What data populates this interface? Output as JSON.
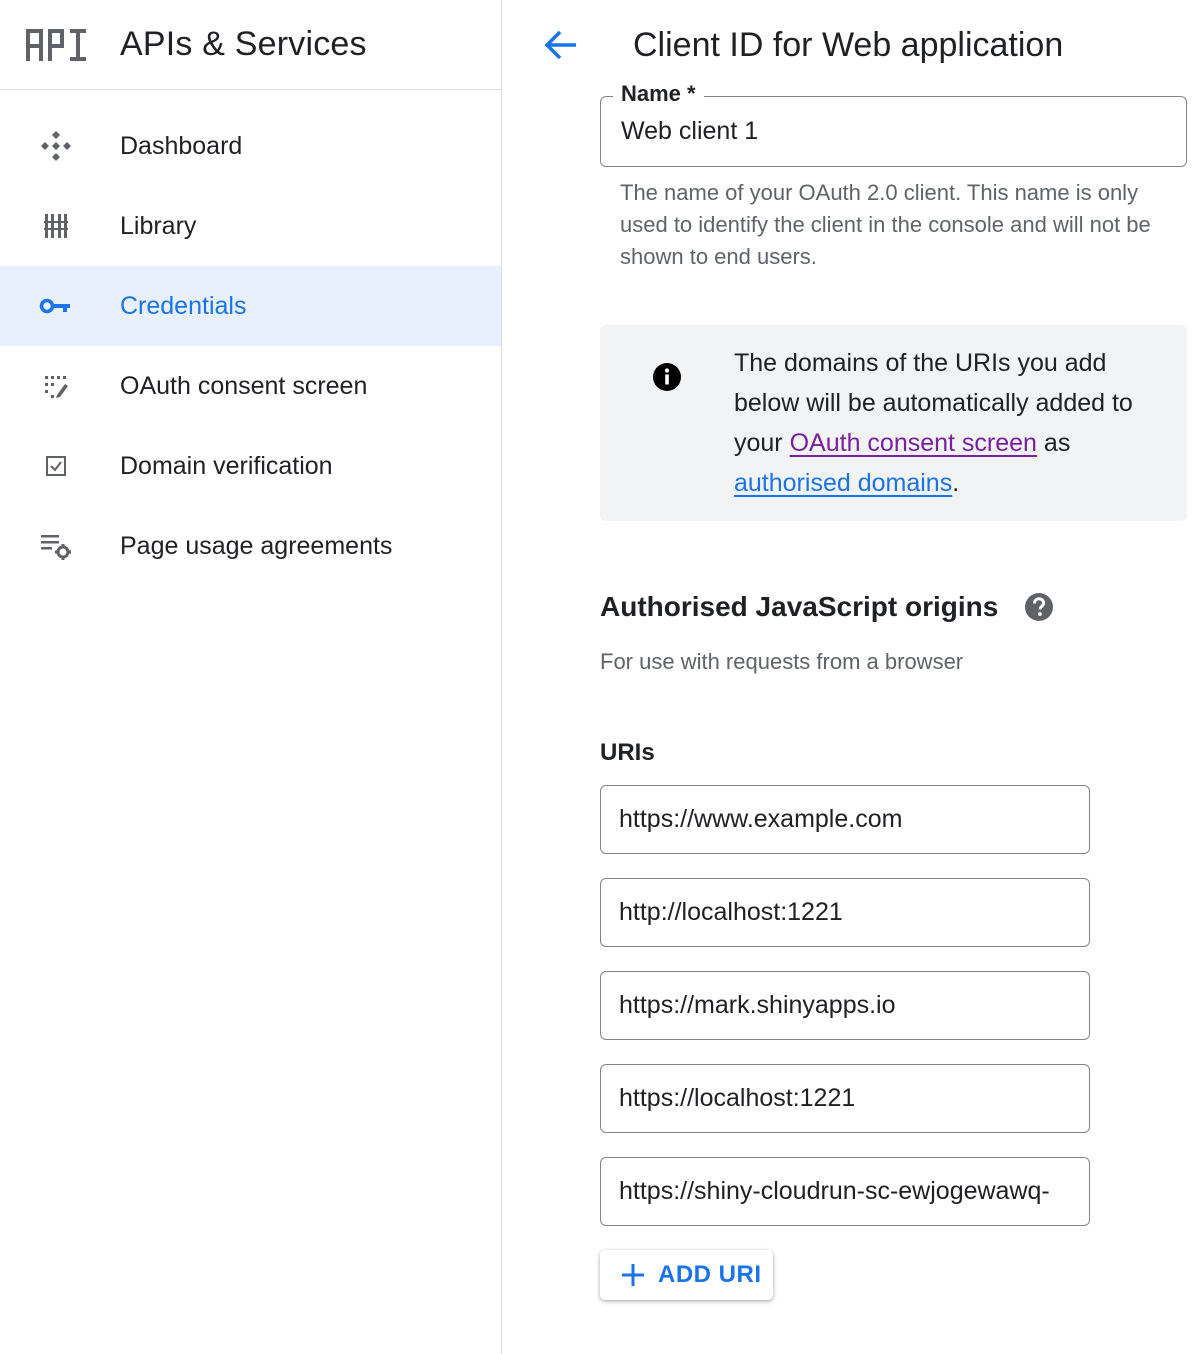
{
  "sidebar": {
    "logo_text": "API",
    "title": "APIs & Services",
    "items": [
      {
        "label": "Dashboard",
        "icon": "dashboard-icon"
      },
      {
        "label": "Library",
        "icon": "library-icon"
      },
      {
        "label": "Credentials",
        "icon": "key-icon",
        "active": true
      },
      {
        "label": "OAuth consent screen",
        "icon": "consent-icon"
      },
      {
        "label": "Domain verification",
        "icon": "checkbox-icon"
      },
      {
        "label": "Page usage agreements",
        "icon": "list-settings-icon"
      }
    ]
  },
  "header": {
    "title": "Client ID for Web application",
    "back_icon": "arrow-left-icon"
  },
  "form": {
    "name_label": "Name *",
    "name_value": "Web client 1",
    "name_hint": "The name of your OAuth 2.0 client. This name is only used to identify the client in the console and will not be shown to end users."
  },
  "info": {
    "text_before": "The domains of the URIs you add below will be automatically added to your ",
    "link1": "OAuth consent screen",
    "text_middle": " as ",
    "link2": "authorised domains",
    "text_after": "."
  },
  "origins": {
    "title": "Authorised JavaScript origins",
    "subtitle": "For use with requests from a browser",
    "uris_label": "URIs",
    "uris": [
      "https://www.example.com",
      "http://localhost:1221",
      "https://mark.shinyapps.io",
      "https://localhost:1221",
      "https://shiny-cloudrun-sc-ewjogewawq-"
    ],
    "add_button": "ADD URI"
  },
  "colors": {
    "accent": "#1a73e8",
    "active_bg": "#e8f0fe",
    "visited_link": "#7b1fa2",
    "info_bg": "#f1f3f4"
  }
}
